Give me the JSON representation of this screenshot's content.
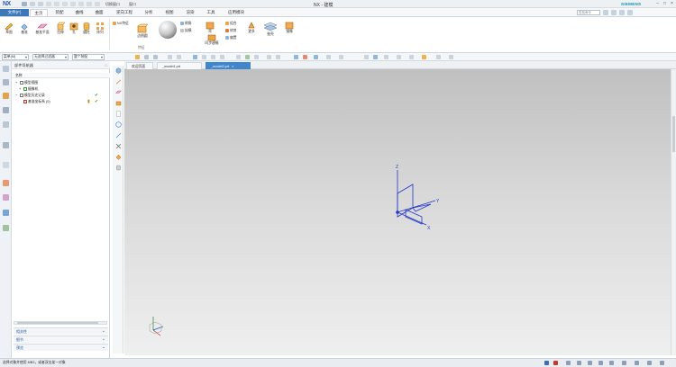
{
  "titlebar": {
    "logo": "NX",
    "quick_access": [
      "切换窗口",
      "窗口"
    ],
    "title": "NX - 建模",
    "brand": "SIEMENS"
  },
  "ribbon": {
    "file_tab": "文件(F)",
    "tabs": [
      "主页",
      "装配",
      "曲线",
      "曲面",
      "逆向工程",
      "分析",
      "视图",
      "渲染",
      "工具",
      "应用模块"
    ],
    "active_tab": "主页",
    "search_placeholder": "查找命令",
    "buttons": [
      {
        "label": "草图",
        "icon": "sketch-icon"
      },
      {
        "label": "基准"
      },
      {
        "label": "基准平面"
      },
      {
        "label": "拉伸"
      },
      {
        "label": "孔"
      },
      {
        "label": "圆柱"
      },
      {
        "label": "阵列"
      },
      {
        "label": "NX特征"
      },
      {
        "label": "边倒圆"
      },
      {
        "label": "倒角"
      },
      {
        "label": "拔模"
      },
      {
        "label": "壳"
      },
      {
        "label": "同步建模"
      },
      {
        "label": "更多"
      },
      {
        "label": "抽壳"
      },
      {
        "label": "镜像"
      },
      {
        "label": "合并"
      },
      {
        "label": "分割面"
      }
    ],
    "small_items": [
      "组合",
      "修剪",
      "偏置"
    ],
    "group_label": "特征"
  },
  "selection_bar": {
    "filter_label": "菜单(M)",
    "filter_value": "无选择过滤器",
    "scope_value": "整个装配"
  },
  "navigator": {
    "title": "部件导航器",
    "column_name": "名称",
    "rows": [
      {
        "label": "模型视图",
        "level": 0
      },
      {
        "label": "摄像机",
        "level": 1
      },
      {
        "label": "模型历史记录",
        "level": 0
      },
      {
        "label": "基准坐标系 (0)",
        "level": 1
      }
    ],
    "panels": [
      "相关性",
      "细节",
      "预览"
    ]
  },
  "doc_tabs": [
    {
      "label": "欢迎页面",
      "active": false
    },
    {
      "label": "_model1.prt",
      "active": false
    },
    {
      "label": "_model2.prt",
      "active": true
    }
  ],
  "axes": {
    "x": "X",
    "y": "Y",
    "z": "Z"
  },
  "status_text": "选择对象并使用 MB3，或者双击某一对象"
}
